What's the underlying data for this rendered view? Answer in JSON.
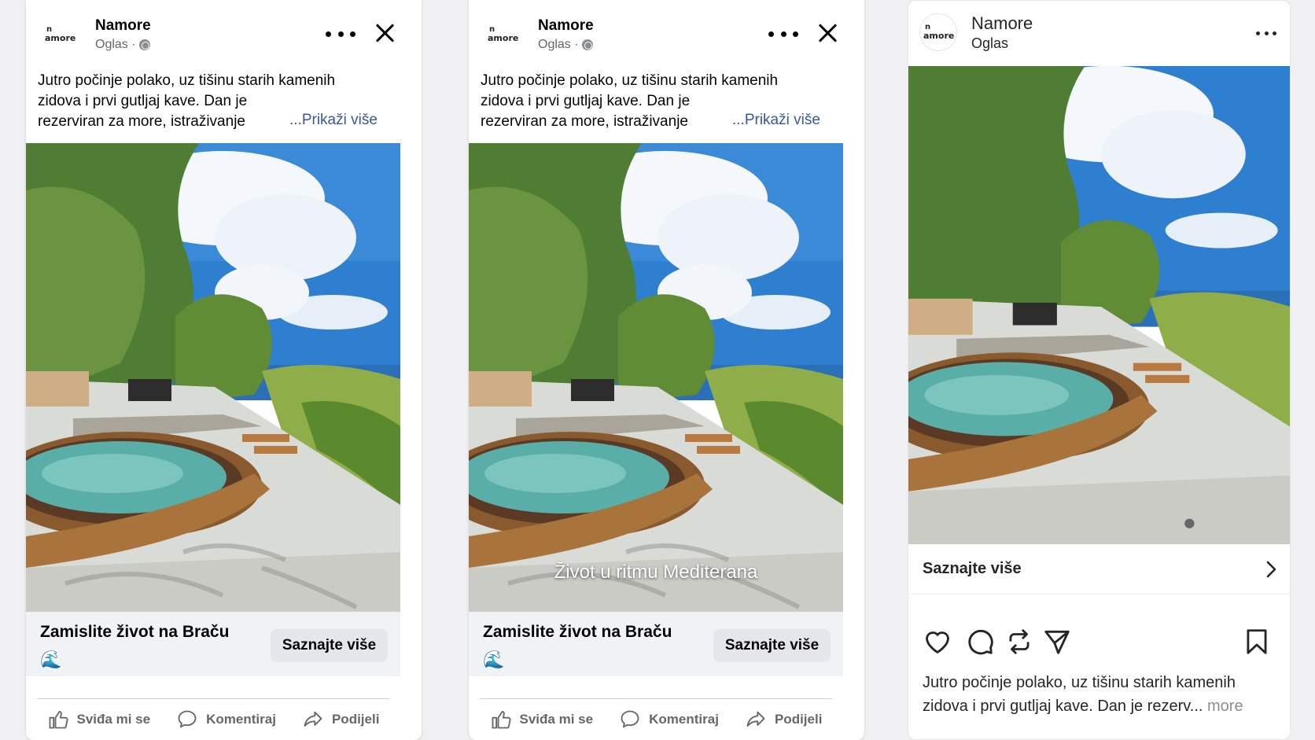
{
  "logo": {
    "line1": "n",
    "line2": "amore"
  },
  "ads": [
    {
      "brand": "Namore",
      "sponsored": "Oglas ·",
      "text_lines": [
        "Jutro počinje polako, uz tišinu starih kamenih",
        "zidova i prvi gutljaj kave. Dan je",
        "rezerviran za more, istraživanje"
      ],
      "see_more": "...Prikaži više",
      "overlay": "",
      "headline": "Zamislite život na Braču",
      "emoji": "🌊",
      "cta": "Saznajte više",
      "actions": {
        "like": "Sviđa mi se",
        "comment": "Komentiraj",
        "share": "Podijeli"
      }
    },
    {
      "brand": "Namore",
      "sponsored": "Oglas ·",
      "text_lines": [
        "Jutro počinje polako, uz tišinu starih kamenih",
        "zidova i prvi gutljaj kave. Dan je",
        "rezerviran za more, istraživanje"
      ],
      "see_more": "...Prikaži više",
      "overlay": "Život u ritmu Mediterana",
      "headline": "Zamislite život na Braču",
      "emoji": "🌊",
      "cta": "Saznajte više",
      "actions": {
        "like": "Sviđa mi se",
        "comment": "Komentiraj",
        "share": "Podijeli"
      }
    }
  ],
  "instagram": {
    "brand": "Namore",
    "sponsored": "Oglas",
    "cta": "Saznajte više",
    "caption_lines": [
      "Jutro počinje polako, uz tišinu starih kamenih",
      "zidova i prvi gutljaj kave. Dan je rezerv..."
    ],
    "more": "more"
  }
}
